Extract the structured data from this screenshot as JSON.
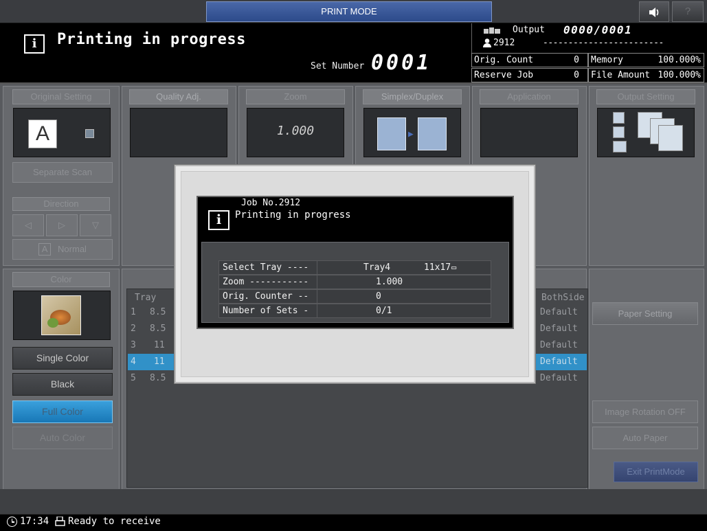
{
  "topbar": {
    "mode_title": "PRINT MODE",
    "sound_icon": "speaker-icon",
    "help_label": "?"
  },
  "header": {
    "status_title": "Printing in progress",
    "set_number_label": "Set Number",
    "set_number_value": "0001",
    "output_label": "Output",
    "output_value": "0000/0001",
    "user_id": "2912",
    "output_dashes": "------------------------",
    "orig_count_label": "Orig. Count",
    "orig_count_value": "0",
    "reserve_job_label": "Reserve Job",
    "reserve_job_value": "0",
    "memory_label": "Memory",
    "memory_value": "100.000%",
    "file_amount_label": "File Amount",
    "file_amount_value": "100.000%"
  },
  "tiles": {
    "original_setting": "Original Setting",
    "quality_adj": "Quality Adj.",
    "zoom": "Zoom",
    "zoom_value": "1.000",
    "simplex_duplex": "Simplex/Duplex",
    "application": "Application",
    "output_setting": "Output Setting",
    "separate_scan": "Separate Scan",
    "direction": "Direction",
    "normal": "Normal",
    "color": "Color"
  },
  "color_buttons": {
    "single_color": "Single Color",
    "black": "Black",
    "full_color": "Full Color",
    "auto_color": "Auto Color"
  },
  "table": {
    "header_tray": "Tray",
    "header_both_side": "BothSide",
    "rows": [
      {
        "num": "1",
        "size": "8.5",
        "mode": "Default"
      },
      {
        "num": "2",
        "size": "8.5",
        "mode": "Default"
      },
      {
        "num": "3",
        "size": "11",
        "mode": "Default"
      },
      {
        "num": "4",
        "size": "11",
        "mode": "Default"
      },
      {
        "num": "5",
        "size": "8.5",
        "mode": "Default"
      }
    ],
    "selected_row": 4
  },
  "right_buttons": {
    "paper_setting": "Paper Setting",
    "image_rotation": "Image Rotation OFF",
    "auto_paper": "Auto Paper",
    "exit_print_mode": "Exit PrintMode"
  },
  "statusbar": {
    "time": "17:34",
    "message": "Ready to receive"
  },
  "dialog": {
    "job_number": "Job No.2912",
    "message": "Printing in progress",
    "rows": [
      {
        "label": "Select Tray ----",
        "value": "Tray4",
        "extra": "11x17"
      },
      {
        "label": "Zoom -----------",
        "value": "1.000",
        "extra": ""
      },
      {
        "label": "Orig. Counter --",
        "value": "0",
        "extra": ""
      },
      {
        "label": "Number of Sets -",
        "value": "0/1",
        "extra": ""
      }
    ]
  }
}
